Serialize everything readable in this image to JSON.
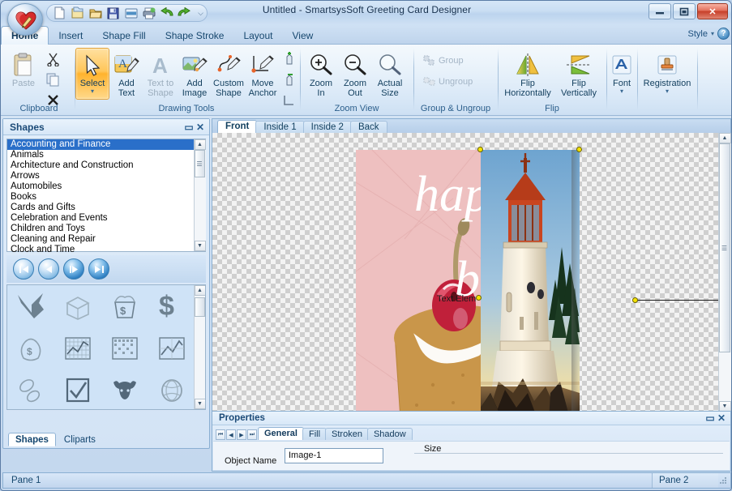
{
  "window": {
    "title": "Untitled - SmartsysSoft Greeting Card Designer",
    "minimize_label": "–",
    "maximize_label": "□",
    "close_label": "✕",
    "app_icon": "heart-pencil-logo"
  },
  "quick_access": {
    "more_label": "⌵",
    "items": [
      {
        "name": "new-document-icon",
        "label": "New"
      },
      {
        "name": "duplicate-icon",
        "label": "Duplicate"
      },
      {
        "name": "open-folder-icon",
        "label": "Open"
      },
      {
        "name": "save-icon",
        "label": "Save"
      },
      {
        "name": "page-setup-icon",
        "label": "Page Setup"
      },
      {
        "name": "print-icon",
        "label": "Print"
      },
      {
        "name": "undo-icon",
        "label": "Undo"
      },
      {
        "name": "redo-icon",
        "label": "Redo"
      }
    ]
  },
  "ribbon_tabs": [
    {
      "label": "Home",
      "active": true
    },
    {
      "label": "Insert",
      "active": false
    },
    {
      "label": "Shape Fill",
      "active": false
    },
    {
      "label": "Shape Stroke",
      "active": false
    },
    {
      "label": "Layout",
      "active": false
    },
    {
      "label": "View",
      "active": false
    }
  ],
  "tabbar_right": {
    "style_label": "Style",
    "style_caret": "▾",
    "help_label": "?"
  },
  "ribbon_groups": [
    {
      "name": "clipboard",
      "label": "Clipboard",
      "buttons": [
        {
          "label": "Paste",
          "name": "paste-button",
          "state": "disabled"
        },
        {
          "label": "Cut",
          "name": "cut-button",
          "state": "normal"
        },
        {
          "label": "Copy",
          "name": "copy-button",
          "state": "normal"
        },
        {
          "label": "Delete",
          "name": "delete-button",
          "state": "normal"
        }
      ]
    },
    {
      "name": "drawing-tools",
      "label": "Drawing Tools",
      "buttons": [
        {
          "label": "Select",
          "name": "select-tool",
          "state": "selected",
          "caret": "▾"
        },
        {
          "label": "Add Text",
          "name": "add-text-tool",
          "state": "normal"
        },
        {
          "label": "Text to Shape",
          "name": "text-to-shape-tool",
          "state": "disabled"
        },
        {
          "label": "Add Image",
          "name": "add-image-tool",
          "state": "normal"
        },
        {
          "label": "Custom Shape",
          "name": "custom-shape-tool",
          "state": "normal"
        },
        {
          "label": "Move Anchor",
          "name": "move-anchor-tool",
          "state": "normal"
        },
        {
          "label": "Add Anchor",
          "name": "add-anchor-tool",
          "state": "normal"
        },
        {
          "label": "Remove Anchor",
          "name": "remove-anchor-tool",
          "state": "normal"
        },
        {
          "label": "Path",
          "name": "path-tool",
          "state": "normal"
        }
      ]
    },
    {
      "name": "zoom-view",
      "label": "Zoom View",
      "buttons": [
        {
          "label": "Zoom In",
          "name": "zoom-in-button",
          "state": "normal",
          "caret": "▾"
        },
        {
          "label": "Zoom Out",
          "name": "zoom-out-button",
          "state": "normal",
          "caret": "▾"
        },
        {
          "label": "Actual Size",
          "name": "actual-size-button",
          "state": "normal"
        }
      ]
    },
    {
      "name": "group-ungroup",
      "label": "Group & Ungroup",
      "buttons": [
        {
          "label": "Group",
          "name": "group-button",
          "state": "disabled"
        },
        {
          "label": "Ungroup",
          "name": "ungroup-button",
          "state": "disabled"
        }
      ]
    },
    {
      "name": "flip",
      "label": "Flip",
      "buttons": [
        {
          "label": "Flip Horizontally",
          "name": "flip-horizontally-button",
          "state": "normal"
        },
        {
          "label": "Flip Vertically",
          "name": "flip-vertically-button",
          "state": "normal"
        }
      ]
    },
    {
      "name": "font",
      "label": "",
      "buttons": [
        {
          "label": "Font",
          "name": "font-button",
          "state": "normal",
          "caret": "▾"
        }
      ]
    },
    {
      "name": "registration",
      "label": "",
      "buttons": [
        {
          "label": "Registration",
          "name": "registration-button",
          "state": "normal",
          "caret": "▾"
        }
      ]
    }
  ],
  "shapes_panel": {
    "title": "Shapes",
    "pin_icon": "▭",
    "close_icon": "✕",
    "categories": [
      {
        "label": "Accounting and Finance",
        "selected": true
      },
      {
        "label": "Animals",
        "selected": false
      },
      {
        "label": "Architecture and Construction",
        "selected": false
      },
      {
        "label": "Arrows",
        "selected": false
      },
      {
        "label": "Automobiles",
        "selected": false
      },
      {
        "label": "Books",
        "selected": false
      },
      {
        "label": "Cards and Gifts",
        "selected": false
      },
      {
        "label": "Celebration and Events",
        "selected": false
      },
      {
        "label": "Children and Toys",
        "selected": false
      },
      {
        "label": "Cleaning and Repair",
        "selected": false
      },
      {
        "label": "Clock and Time",
        "selected": false
      }
    ],
    "nav_buttons": [
      {
        "name": "first-page-button",
        "glyph": "⏮",
        "active": false
      },
      {
        "name": "previous-page-button",
        "glyph": "◀",
        "active": false
      },
      {
        "name": "next-page-button",
        "glyph": "▶",
        "active": true
      },
      {
        "name": "last-page-button",
        "glyph": "⏭",
        "active": true
      }
    ],
    "shape_thumbnails": [
      "arrow-down-up-icon",
      "open-box-icon",
      "money-basket-icon",
      "dollar-sign-icon",
      "money-bag-icon",
      "line-chart-grid-icon",
      "data-table-icon",
      "area-chart-icon",
      "pills-icon",
      "checkbox-checked-icon",
      "bull-head-icon",
      "coin-icon",
      "cash-stack-icon",
      "banknotes-icon",
      "dollar-symbols-icon",
      "price-tag-icon"
    ],
    "bottom_tabs": [
      {
        "label": "Shapes",
        "active": true
      },
      {
        "label": "Cliparts",
        "active": false
      }
    ]
  },
  "canvas": {
    "tabs": [
      {
        "label": "Front",
        "active": true
      },
      {
        "label": "Inside 1",
        "active": false
      },
      {
        "label": "Inside 2",
        "active": false
      },
      {
        "label": "Back",
        "active": false
      }
    ],
    "text_element_label": "Text Elem",
    "card_text_line1": "happy",
    "card_text_line2": "bi",
    "scroll_up_glyph": "▲",
    "scroll_down_glyph": "▼"
  },
  "properties": {
    "title": "Properties",
    "pin_icon": "▭",
    "close_icon": "✕",
    "nav_buttons": [
      "⏮",
      "◀",
      "▶",
      "⏭"
    ],
    "tabs": [
      {
        "label": "General",
        "active": true
      },
      {
        "label": "Fill",
        "active": false
      },
      {
        "label": "Stroken",
        "active": false
      },
      {
        "label": "Shadow",
        "active": false
      }
    ],
    "object_name_label": "Object Name",
    "object_name_value": "Image-1",
    "size_label": "Size"
  },
  "status_bar": {
    "pane1": "Pane 1",
    "pane2": "Pane 2"
  },
  "colors": {
    "accent": "#2a6fc9",
    "selected_tool": "#ffb32e",
    "handle_yellow": "#f5e400",
    "handle_green": "#12c212",
    "close_red": "#c73f29",
    "card_pink": "#eec0c0"
  }
}
